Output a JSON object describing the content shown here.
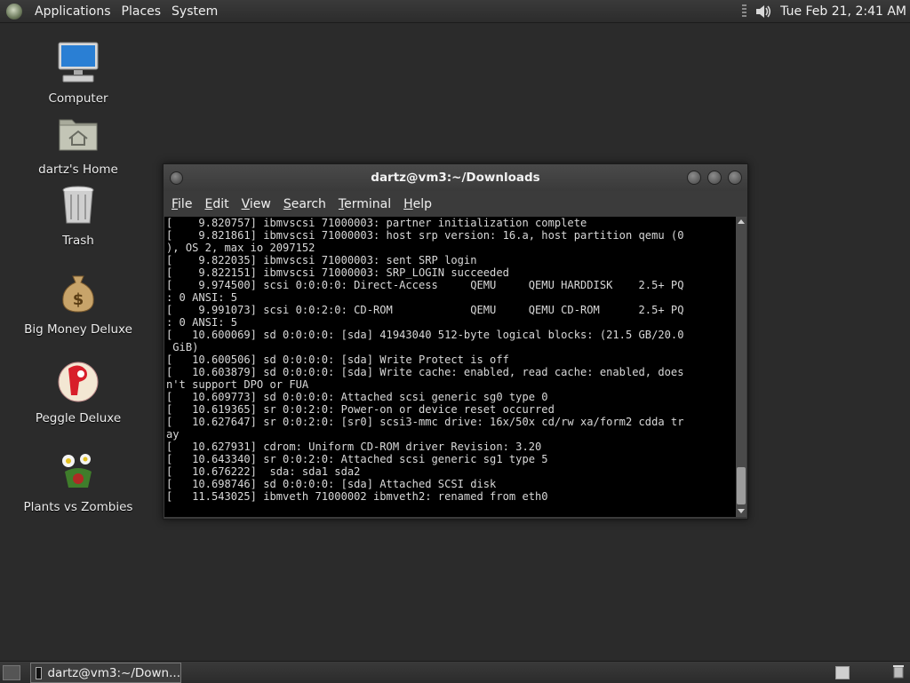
{
  "top_panel": {
    "menus": [
      "Applications",
      "Places",
      "System"
    ],
    "clock": "Tue Feb 21,  2:41 AM",
    "icons": {
      "logo": "gnome-foot-icon",
      "volume": "speaker-icon"
    }
  },
  "desktop_icons": [
    {
      "label": "Computer",
      "icon": "computer-icon"
    },
    {
      "label": "dartz's Home",
      "icon": "home-folder-icon"
    },
    {
      "label": "Trash",
      "icon": "trash-icon"
    },
    {
      "label": "Big Money Deluxe",
      "icon": "money-bag-icon"
    },
    {
      "label": "Peggle Deluxe",
      "icon": "peggle-icon"
    },
    {
      "label": "Plants vs Zombies",
      "icon": "plants-zombies-icon"
    }
  ],
  "terminal": {
    "title": "dartz@vm3:~/Downloads",
    "menus": [
      "File",
      "Edit",
      "View",
      "Search",
      "Terminal",
      "Help"
    ],
    "menu_mnemonics": [
      "F",
      "E",
      "V",
      "S",
      "T",
      "H"
    ],
    "lines": [
      "[    9.820757] ibmvscsi 71000003: partner initialization complete",
      "[    9.821861] ibmvscsi 71000003: host srp version: 16.a, host partition qemu (0",
      "), OS 2, max io 2097152",
      "[    9.822035] ibmvscsi 71000003: sent SRP login",
      "[    9.822151] ibmvscsi 71000003: SRP_LOGIN succeeded",
      "[    9.974500] scsi 0:0:0:0: Direct-Access     QEMU     QEMU HARDDISK    2.5+ PQ",
      ": 0 ANSI: 5",
      "[    9.991073] scsi 0:0:2:0: CD-ROM            QEMU     QEMU CD-ROM      2.5+ PQ",
      ": 0 ANSI: 5",
      "[   10.600069] sd 0:0:0:0: [sda] 41943040 512-byte logical blocks: (21.5 GB/20.0",
      " GiB)",
      "[   10.600506] sd 0:0:0:0: [sda] Write Protect is off",
      "[   10.603879] sd 0:0:0:0: [sda] Write cache: enabled, read cache: enabled, does",
      "n't support DPO or FUA",
      "[   10.609773] sd 0:0:0:0: Attached scsi generic sg0 type 0",
      "[   10.619365] sr 0:0:2:0: Power-on or device reset occurred",
      "[   10.627647] sr 0:0:2:0: [sr0] scsi3-mmc drive: 16x/50x cd/rw xa/form2 cdda tr",
      "ay",
      "[   10.627931] cdrom: Uniform CD-ROM driver Revision: 3.20",
      "[   10.643340] sr 0:0:2:0: Attached scsi generic sg1 type 5",
      "[   10.676222]  sda: sda1 sda2",
      "[   10.698746] sd 0:0:0:0: [sda] Attached SCSI disk",
      "[   11.543025] ibmveth 71000002 ibmveth2: renamed from eth0"
    ]
  },
  "bottom_panel": {
    "task_label": "dartz@vm3:~/Down...",
    "icons": {
      "show_desktop": "show-desktop-icon",
      "task": "terminal-icon",
      "workspace": "workspace-switcher-icon",
      "trash": "trash-applet-icon"
    }
  }
}
